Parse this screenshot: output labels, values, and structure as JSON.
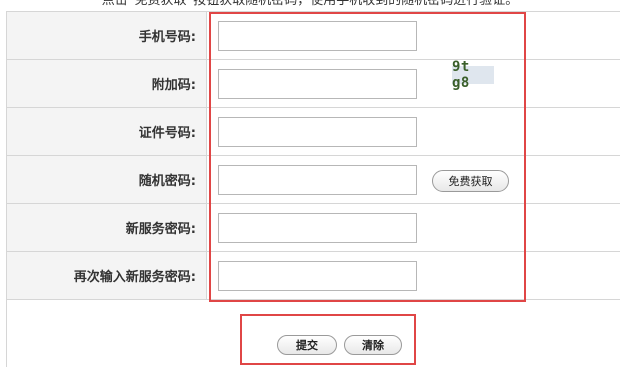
{
  "notice": "点击“免费获取”按钮获取随机密码，使用手机收到的随机密码进行验证。",
  "form": {
    "rows": [
      {
        "label": "手机号码:",
        "value": ""
      },
      {
        "label": "附加码:",
        "value": ""
      },
      {
        "label": "证件号码:",
        "value": ""
      },
      {
        "label": "随机密码:",
        "value": ""
      },
      {
        "label": "新服务密码:",
        "value": ""
      },
      {
        "label": "再次输入新服务密码:",
        "value": ""
      }
    ],
    "captcha_text": "9t g8",
    "get_code_label": "免费获取"
  },
  "buttons": {
    "submit_label": "提交",
    "clear_label": "清除"
  },
  "colors": {
    "highlight_border": "#e04646",
    "label_background": "#f4f4f4"
  }
}
